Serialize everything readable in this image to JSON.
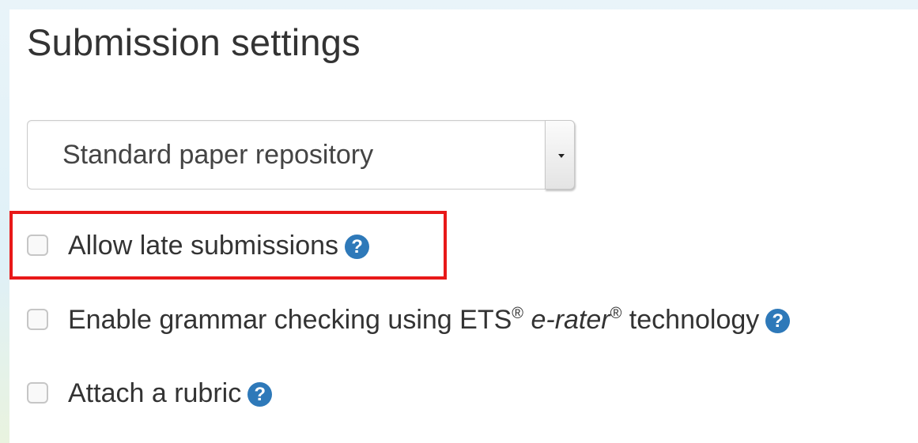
{
  "page": {
    "title": "Submission settings"
  },
  "repository_select": {
    "value": "Standard paper repository"
  },
  "options": {
    "late": {
      "label": "Allow late submissions",
      "checked": false
    },
    "grammar": {
      "label_part1": "Enable grammar checking using ETS",
      "reg_mark": "®",
      "label_italic": "e-rater",
      "reg_mark2": "®",
      "label_part2": " technology",
      "checked": false
    },
    "rubric": {
      "label": "Attach a rubric",
      "checked": false
    }
  },
  "icons": {
    "help": "question-circle-icon",
    "help_glyph": "?"
  },
  "colors": {
    "help_icon": "#2e79b9",
    "highlight_box": "#e81919"
  }
}
